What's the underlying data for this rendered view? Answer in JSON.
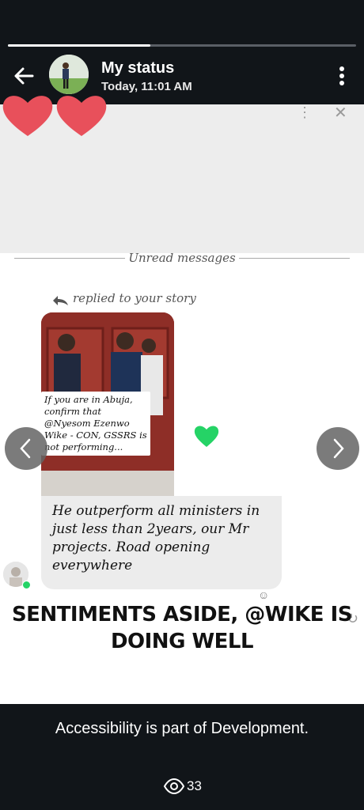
{
  "status": {
    "progress": 0.41,
    "title": "My status",
    "time": "Today, 11:01 AM"
  },
  "story": {
    "unread_label": "Unread messages",
    "replied_label": "replied to your story",
    "image_caption": "If you are in Abuja, confirm that @Nyesom Ezenwo Wike - CON, GSSRS is not performing...",
    "reply_text": "He outperform all ministers in just less than 2years, our Mr projects. Road opening everywhere",
    "headline": "SENTIMENTS ASIDE, @WIKE IS DOING WELL"
  },
  "footer": {
    "caption": "Accessibility is part of Development.",
    "views": "33"
  },
  "colors": {
    "background": "#111519",
    "heart_red": "#e8505b",
    "heart_green": "#25d366"
  },
  "icons": [
    "back-arrow-icon",
    "more-vert-icon",
    "heart-icon",
    "reply-arrow-icon",
    "chevron-left-icon",
    "chevron-right-icon",
    "eye-icon"
  ]
}
